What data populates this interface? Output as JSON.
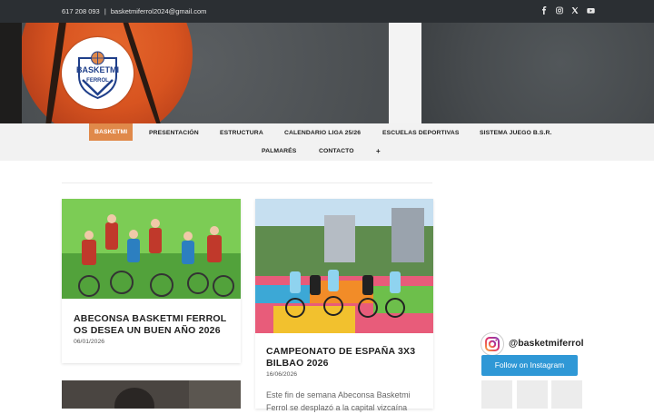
{
  "topbar": {
    "phone": "617 208 093",
    "separator": "|",
    "email": "basketmiferrol2024@gmail.com",
    "social_icons": [
      "facebook-icon",
      "instagram-icon",
      "x-icon",
      "youtube-icon"
    ]
  },
  "logo": {
    "text_top": "BASKETMI",
    "text_bottom": "FERROL"
  },
  "nav": {
    "items": [
      "BASKETMI",
      "PRESENTACIÓN",
      "ESTRUCTURA",
      "CALENDARIO LIGA 25/26",
      "ESCUELAS DEPORTIVAS",
      "SISTEMA JUEGO B.S.R.",
      "PALMARÉS",
      "CONTACTO",
      "+"
    ],
    "active_index": 0
  },
  "posts": [
    {
      "title_line1": "ABECONSA BASKETMI FERROL",
      "title_line2": "OS DESEA UN BUEN AÑO 2026",
      "date": "06/01/2026"
    },
    {
      "title_line1": "CAMPEONATO DE ESPAÑA 3X3",
      "title_line2": "BILBAO 2026",
      "date": "16/06/2026",
      "excerpt_line1": "Este fin de semana Abeconsa Basketmi",
      "excerpt_line2": "Ferrol se desplazó a la capital vizcaína"
    }
  ],
  "instagram": {
    "handle": "@basketmiferrol",
    "follow_label": "Follow on Instagram"
  },
  "colors": {
    "accent": "#e0894a",
    "topbar": "#2b2f33",
    "instagram_button": "#2f98d6"
  }
}
